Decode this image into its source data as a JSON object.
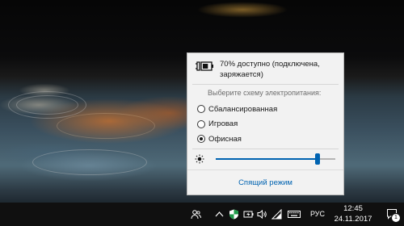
{
  "battery_flyout": {
    "status_text": "70% доступно (подключена, заряжается)",
    "battery_percent": 70,
    "scheme_title": "Выберите схему электропитания:",
    "power_schemes": [
      {
        "label": "Сбалансированная",
        "selected": false
      },
      {
        "label": "Игровая",
        "selected": false
      },
      {
        "label": "Офисная",
        "selected": true
      }
    ],
    "brightness_level": 0.85,
    "sleep_link": "Спящий режим",
    "accent_color": "#0063b1"
  },
  "taskbar": {
    "language": "РУС",
    "time": "12:45",
    "date": "24.11.2017",
    "notification_count": "1",
    "tray_icons": [
      "people-icon",
      "chevron-up-icon",
      "defender-icon",
      "battery-icon",
      "volume-icon",
      "wifi-icon",
      "keyboard-icon",
      "language-indicator",
      "clock",
      "action-center-icon"
    ]
  }
}
